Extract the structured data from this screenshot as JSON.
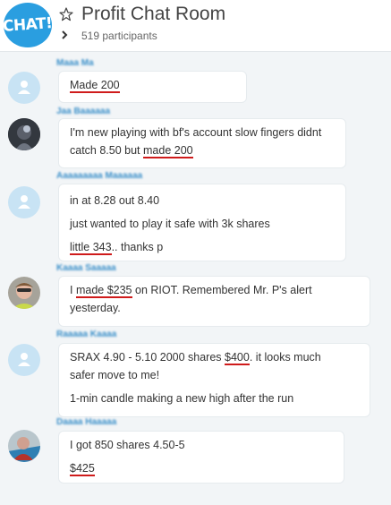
{
  "header": {
    "logo_text": "CHAT!",
    "title": "Profit Chat Room",
    "participants": "519 participants",
    "icons": {
      "star": "star-icon",
      "expand": "chevron-right-icon"
    },
    "accent_color": "#2a9ee0"
  },
  "messages": [
    {
      "author": "Maaa Ma",
      "avatar": "generic-user",
      "lines": [
        {
          "parts": [
            {
              "text": "Made 200",
              "underline": true
            }
          ]
        }
      ]
    },
    {
      "author": "Jaa Baaaaaa",
      "avatar": "photo",
      "lines": [
        {
          "parts": [
            {
              "text": "I'm new playing with bf's account slow fingers didnt"
            }
          ]
        },
        {
          "parts": [
            {
              "text": "catch 8.50 but "
            },
            {
              "text": "made 200",
              "underline": true
            }
          ]
        }
      ]
    },
    {
      "author": "Aaaaaaaaa Maaaaaa",
      "avatar": "generic-user",
      "lines": [
        {
          "parts": [
            {
              "text": "in at 8.28 out 8.40"
            }
          ]
        },
        {
          "parts": [
            {
              "text": "just wanted to play it safe with 3k shares"
            }
          ]
        },
        {
          "parts": [
            {
              "text": "little 343",
              "underline": true
            },
            {
              "text": ".. thanks p"
            }
          ]
        }
      ]
    },
    {
      "author": "Kaaaa Saaaaa",
      "avatar": "photo",
      "lines": [
        {
          "parts": [
            {
              "text": "I "
            },
            {
              "text": "made $235",
              "underline": true
            },
            {
              "text": " on RIOT.  Remembered Mr. P's alert"
            }
          ]
        },
        {
          "parts": [
            {
              "text": "yesterday."
            }
          ]
        }
      ]
    },
    {
      "author": "Raaaaa Kaaaa",
      "avatar": "generic-user",
      "lines": [
        {
          "parts": [
            {
              "text": "SRAX 4.90 - 5.10 2000 shares "
            },
            {
              "text": "$400",
              "underline": true
            },
            {
              "text": ". it looks much"
            }
          ]
        },
        {
          "parts": [
            {
              "text": "safer move to me!"
            }
          ]
        },
        {
          "parts": [
            {
              "text": "1-min candle making a new high after the run"
            }
          ]
        }
      ]
    },
    {
      "author": "Daaaa Haaaaa",
      "avatar": "photo",
      "lines": [
        {
          "parts": [
            {
              "text": "I got 850 shares 4.50-5"
            }
          ]
        },
        {
          "parts": [
            {
              "text": "$425",
              "underline": true
            }
          ]
        }
      ]
    }
  ]
}
